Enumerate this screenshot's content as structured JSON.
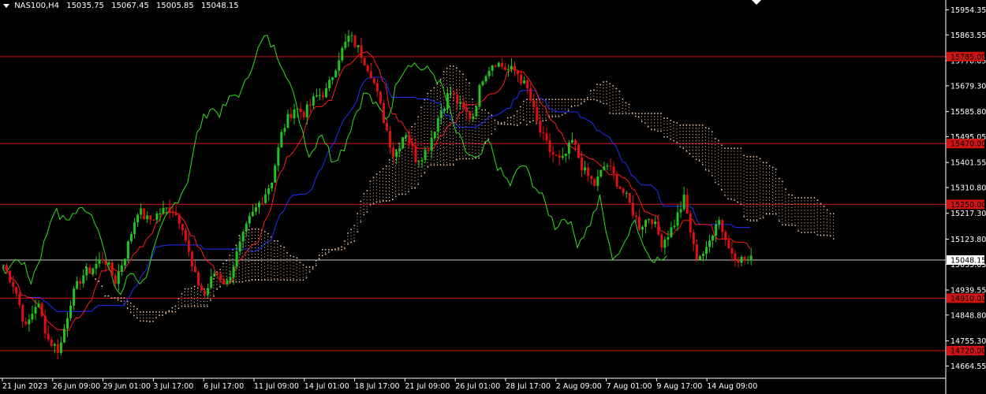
{
  "header": {
    "symbol": "NAS100,H4",
    "open": "15035.75",
    "high": "15067.45",
    "low": "15005.85",
    "close": "15048.15"
  },
  "colors": {
    "background": "#000000",
    "bull": "#22c31d",
    "bear": "#e01010",
    "level_line": "#d01414",
    "tenkan": "#ff1a1a",
    "kijun": "#1f2fff",
    "chikou": "#33dd22",
    "kumo": "#f5c8a8",
    "price_line": "#c8c8c8",
    "axis_text": "#ffffff"
  },
  "chart_data": {
    "type": "candlestick",
    "instrument": "NAS100",
    "timeframe": "H4",
    "indicators": [
      "Ichimoku Kinko Hyo"
    ],
    "ylim": [
      14620,
      15990
    ],
    "y_ticks": [
      "15954.35",
      "15863.55",
      "15770.05",
      "15679.30",
      "15585.80",
      "15495.05",
      "15401.55",
      "15310.80",
      "15217.30",
      "15123.80",
      "15033.05",
      "14939.55",
      "14848.80",
      "14755.30",
      "14664.55"
    ],
    "x_ticks": [
      "21 Jun 2023",
      "26 Jun 09:00",
      "29 Jun 01:00",
      "3 Jul 17:00",
      "6 Jul 17:00",
      "11 Jul 09:00",
      "14 Jul 01:00",
      "18 Jul 17:00",
      "21 Jul 09:00",
      "26 Jul 01:00",
      "28 Jul 17:00",
      "2 Aug 09:00",
      "7 Aug 01:00",
      "9 Aug 17:00",
      "14 Aug 09:00"
    ],
    "current_price": "15048.15",
    "levels": [
      "15785.00",
      "15470.00",
      "15250.00",
      "14910.00",
      "14720.00"
    ],
    "price_path": [
      15030,
      14950,
      14800,
      14900,
      14760,
      14720,
      14900,
      14990,
      15020,
      15060,
      14970,
      15080,
      15230,
      15190,
      15220,
      15240,
      15180,
      15000,
      14920,
      15010,
      14960,
      15080,
      15190,
      15260,
      15330,
      15520,
      15600,
      15580,
      15640,
      15660,
      15780,
      15860,
      15800,
      15720,
      15570,
      15420,
      15520,
      15410,
      15450,
      15570,
      15660,
      15600,
      15560,
      15720,
      15770,
      15740,
      15730,
      15660,
      15520,
      15440,
      15400,
      15480,
      15370,
      15320,
      15400,
      15330,
      15260,
      15170,
      15210,
      15110,
      15170,
      15270,
      15060,
      15080,
      15210,
      15090,
      15050,
      15048
    ]
  }
}
